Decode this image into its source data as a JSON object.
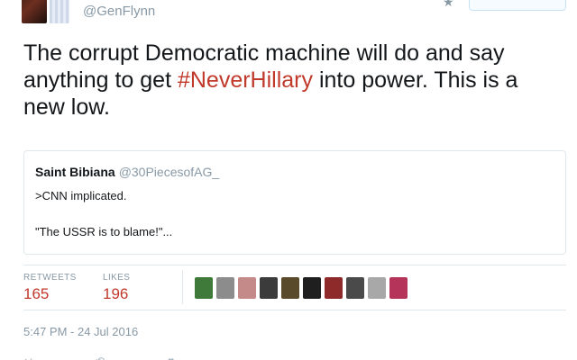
{
  "header": {
    "handle": "@GenFlynn"
  },
  "tweet": {
    "text_before": "The corrupt Democratic machine will do and say anything to get ",
    "hashtag": "#NeverHillary",
    "text_after": " into power. This is a new low."
  },
  "quote": {
    "name": "Saint Bibiana",
    "handle": "@30PiecesofAG_",
    "line1": ">CNN implicated.",
    "line2": "\"The USSR is to blame!\"..."
  },
  "stats": {
    "retweets_label": "RETWEETS",
    "retweets_value": "165",
    "likes_label": "LIKES",
    "likes_value": "196"
  },
  "likers": [
    {
      "icon": "user-avatar-green",
      "color": "#3f7a3a"
    },
    {
      "icon": "user-avatar-gray",
      "color": "#8c8c8c"
    },
    {
      "icon": "user-avatar-pink",
      "color": "#c48a8a"
    },
    {
      "icon": "user-avatar-suit",
      "color": "#3b3b3b"
    },
    {
      "icon": "user-avatar-eagle",
      "color": "#5a4a2c"
    },
    {
      "icon": "user-avatar-skull",
      "color": "#1f1f1f"
    },
    {
      "icon": "user-avatar-red",
      "color": "#8e2a2a"
    },
    {
      "icon": "user-avatar-portrait",
      "color": "#4a4a4a"
    },
    {
      "icon": "user-avatar-tank",
      "color": "#a8a8a8"
    },
    {
      "icon": "user-avatar-flag",
      "color": "#b5345a"
    }
  ],
  "timestamp": "5:47 PM - 24 Jul 2016",
  "colors": {
    "accent": "#c0392b",
    "muted": "#8899a6",
    "border": "#e1e8ed"
  }
}
